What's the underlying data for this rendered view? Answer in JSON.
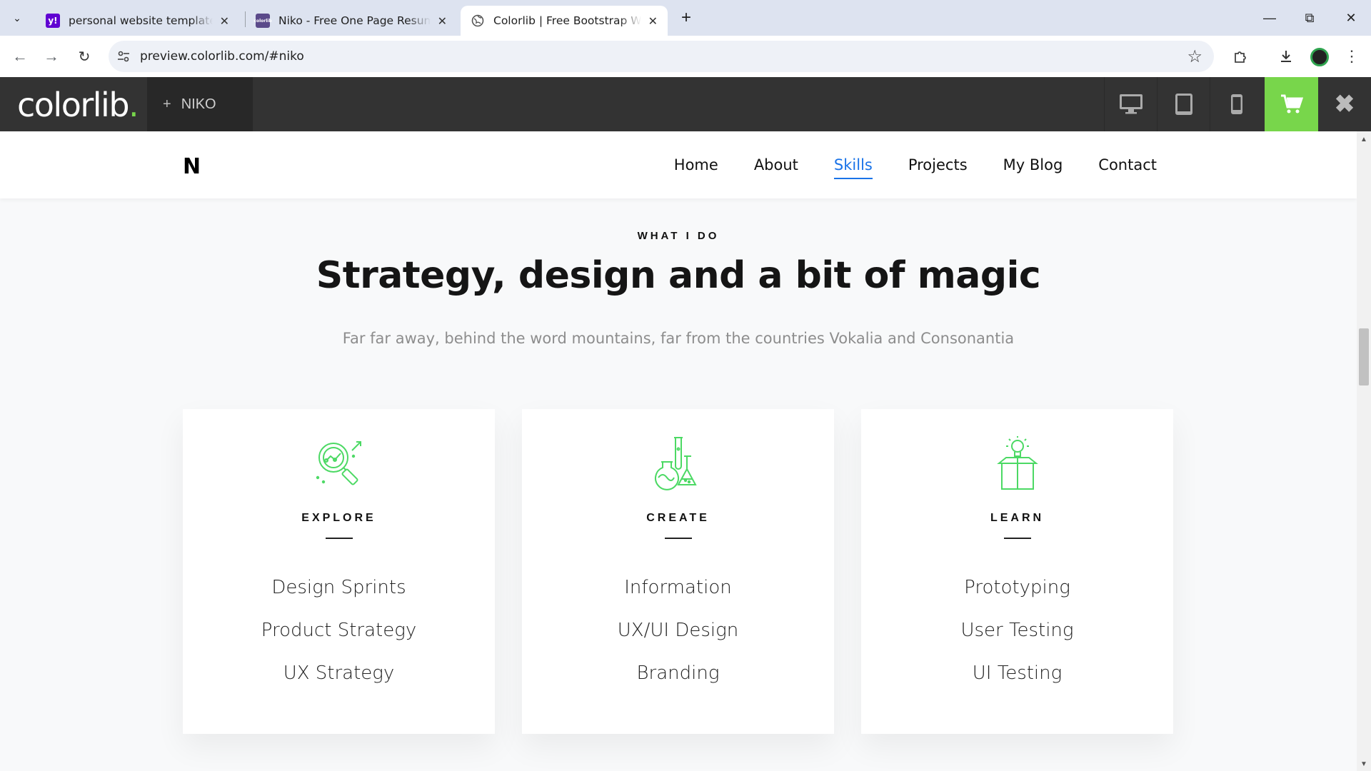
{
  "browser": {
    "tabs": [
      {
        "title": "personal website templates - Ya",
        "favicon": "yahoo-icon",
        "active": false
      },
      {
        "title": "Niko - Free One Page Resume W",
        "favicon": "colorlib-favicon-icon",
        "active": false
      },
      {
        "title": "Colorlib | Free Bootstrap Websit",
        "favicon": "globe-icon",
        "active": true
      }
    ],
    "url": "preview.colorlib.com/#niko"
  },
  "colorlib_bar": {
    "logo": "colorlib",
    "logo_dot": ".",
    "theme_name": "NIKO",
    "accent": "#78d64b"
  },
  "site": {
    "brand": "N",
    "menu": [
      "Home",
      "About",
      "Skills",
      "Projects",
      "My Blog",
      "Contact"
    ],
    "active_menu": "Skills",
    "eyebrow": "WHAT I DO",
    "headline": "Strategy, design and a bit of magic",
    "subline": "Far far away, behind the word mountains, far from the countries Vokalia and Consonantia",
    "cards": [
      {
        "icon": "magnifier-analytics-icon",
        "title": "EXPLORE",
        "items": [
          "Design Sprints",
          "Product Strategy",
          "UX Strategy"
        ]
      },
      {
        "icon": "flasks-icon",
        "title": "CREATE",
        "items": [
          "Information",
          "UX/UI Design",
          "Branding"
        ]
      },
      {
        "icon": "lightbulb-box-icon",
        "title": "LEARN",
        "items": [
          "Prototyping",
          "User Testing",
          "UI Testing"
        ]
      }
    ],
    "icon_color": "#4cd964"
  }
}
